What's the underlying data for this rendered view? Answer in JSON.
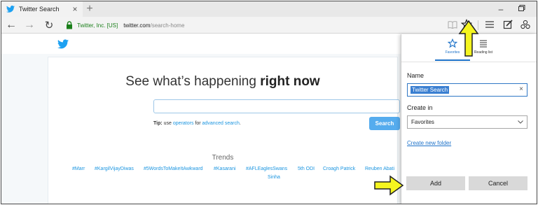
{
  "browser": {
    "tab": {
      "title": "Twitter Search",
      "close_glyph": "×",
      "favicon": "twitter-bird-icon"
    },
    "new_tab_glyph": "+",
    "window_minimize_glyph": "–",
    "navbar": {
      "back_glyph": "←",
      "forward_glyph": "→",
      "refresh_glyph": "↻",
      "site_identity": "Twitter, Inc. [US]",
      "url_host": "twitter.com",
      "url_path": "/search-home"
    }
  },
  "page": {
    "headline_regular": "See what’s happening ",
    "headline_bold": "right now",
    "search_value": "",
    "tip_prefix": "Tip:",
    "tip_use": " use ",
    "tip_operators": "operators",
    "tip_for": " for ",
    "tip_advanced": "advanced search",
    "tip_end": ".",
    "search_button": "Search",
    "trends_title": "Trends",
    "trends": [
      "#Marr",
      "#KargilVijayDiwas",
      "#5WordsToMakeItAwkward",
      "#Kasarani",
      "#AFLEaglesSwans",
      "5th ODI",
      "Croagh Patrick",
      "Reuben Abati",
      "Sinha"
    ]
  },
  "flyout": {
    "tab_favorites": "Favorites",
    "tab_reading_list": "Reading list",
    "name_label": "Name",
    "name_value": "Twitter Search",
    "clear_glyph": "×",
    "create_in_label": "Create in",
    "create_in_value": "Favorites",
    "create_new_folder": "Create new folder",
    "add_button": "Add",
    "cancel_button": "Cancel"
  },
  "colors": {
    "accent_blue": "#1f73c9",
    "twitter_blue": "#55acee",
    "secure_green": "#1a7f1a",
    "annotation_arrow": "#f5f51f"
  }
}
